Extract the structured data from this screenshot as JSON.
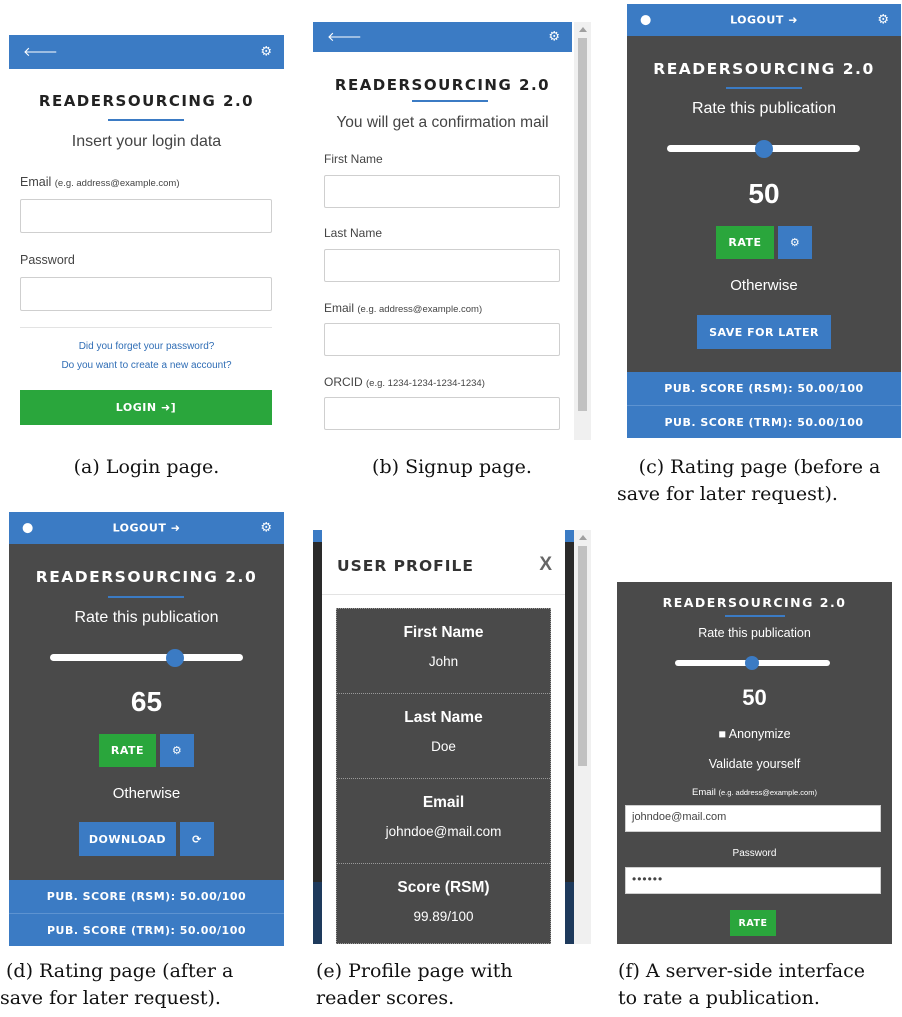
{
  "brand": "READERSOURCING 2.0",
  "icons": {
    "back": "arrow-left-icon",
    "settings": "gear-icon",
    "user": "user-icon",
    "signin": "sign-in-icon",
    "logout": "sign-out-icon",
    "refresh": "refresh-icon"
  },
  "colors": {
    "primary": "#3b7bc4",
    "success": "#2aa63c",
    "dark": "#4a4a4a"
  },
  "login": {
    "subtitle": "Insert your login data",
    "email_label": "Email",
    "email_hint": "(e.g. address@example.com)",
    "password_label": "Password",
    "forgot_link": "Did you forget your password?",
    "create_link": "Do you want to create a new account?",
    "login_button": "LOGIN"
  },
  "signup": {
    "subtitle": "You will get a confirmation mail",
    "first_name_label": "First Name",
    "last_name_label": "Last Name",
    "email_label": "Email",
    "email_hint": "(e.g. address@example.com)",
    "orcid_label": "ORCID",
    "orcid_hint": "(e.g. 1234-1234-1234-1234)"
  },
  "rating_before": {
    "logout": "LOGOUT",
    "prompt": "Rate this publication",
    "value": "50",
    "slider_fraction": 0.5,
    "rate_button": "RATE",
    "otherwise": "Otherwise",
    "save_button": "SAVE FOR LATER",
    "score_rsm": "PUB. SCORE (RSM): 50.00/100",
    "score_trm": "PUB. SCORE (TRM): 50.00/100"
  },
  "rating_after": {
    "logout": "LOGOUT",
    "prompt": "Rate this publication",
    "value": "65",
    "slider_fraction": 0.65,
    "rate_button": "RATE",
    "otherwise": "Otherwise",
    "download_button": "DOWNLOAD",
    "score_rsm": "PUB. SCORE (RSM): 50.00/100",
    "score_trm": "PUB. SCORE (TRM): 50.00/100"
  },
  "profile": {
    "title": "USER PROFILE",
    "close": "X",
    "rows": [
      {
        "label": "First Name",
        "value": "John"
      },
      {
        "label": "Last Name",
        "value": "Doe"
      },
      {
        "label": "Email",
        "value": "johndoe@mail.com"
      },
      {
        "label": "Score (RSM)",
        "value": "99.89/100"
      }
    ]
  },
  "server": {
    "prompt": "Rate this publication",
    "value": "50",
    "slider_fraction": 0.5,
    "anonymize": "Anonymize",
    "validate": "Validate yourself",
    "email_label": "Email",
    "email_hint": "(e.g. address@example.com)",
    "email_value": "johndoe@mail.com",
    "password_label": "Password",
    "password_value": "••••••",
    "rate_button": "RATE"
  },
  "captions": {
    "a": "(a) Login page.",
    "b": "(b) Signup page.",
    "c1": "(c) Rating page (before a",
    "c2": "save for later request).",
    "d1": "(d) Rating page (after a",
    "d2": "save for later request).",
    "e1": "(e) Profile page with",
    "e2": "reader scores.",
    "f1": "(f) A server-side interface",
    "f2": "to rate a publication."
  }
}
